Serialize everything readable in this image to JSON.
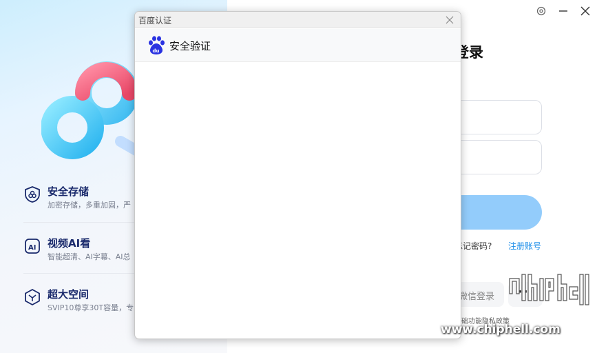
{
  "left_panel": {
    "features": [
      {
        "icon": "shield-icon",
        "title": "安全存储",
        "subtitle": "加密存储，多重加固，严"
      },
      {
        "icon": "ai-icon",
        "title": "视频AI看",
        "subtitle": "智能超清、AI字幕、AI总"
      },
      {
        "icon": "cube-icon",
        "title": "超大空间",
        "subtitle": "SVIP10尊享30T容量，专"
      }
    ]
  },
  "login": {
    "title": "登录",
    "forgot_password": "忘记密码?",
    "register": "注册账号",
    "wechat_login": "微信登录",
    "more": "···",
    "privacy": "基础功能隐私政策"
  },
  "window_controls": [
    "settings-icon",
    "minimize-icon",
    "close-icon"
  ],
  "dialog": {
    "window_title": "百度认证",
    "heading": "安全验证"
  },
  "watermark": {
    "brand": "chip hell",
    "url": "www.chiphell.com"
  },
  "colors": {
    "accent": "#1a8ce8",
    "login_button": "#93ccfb",
    "feature_title": "#1a2a6c",
    "baidu_blue": "#2932e1",
    "logo_pink": "#f05a78",
    "logo_cyan": "#4fd1f3"
  }
}
